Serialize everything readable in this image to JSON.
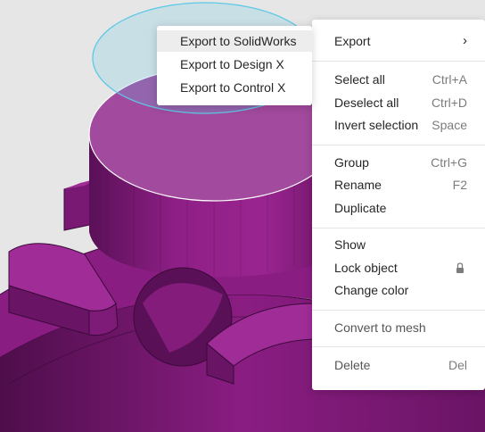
{
  "colors": {
    "background": "#e6e6e6",
    "part": "#8e1f86",
    "part_dark": "#5a1057",
    "selection_fill": "#a24a9e",
    "selection_outline": "#5ec8e6",
    "menu_bg": "#ffffff"
  },
  "context_menu": {
    "export": {
      "label": "Export",
      "submenu_icon": "chevron-right"
    },
    "select_all": {
      "label": "Select all",
      "shortcut": "Ctrl+A"
    },
    "deselect_all": {
      "label": "Deselect all",
      "shortcut": "Ctrl+D"
    },
    "invert_selection": {
      "label": "Invert selection",
      "shortcut": "Space"
    },
    "group": {
      "label": "Group",
      "shortcut": "Ctrl+G"
    },
    "rename": {
      "label": "Rename",
      "shortcut": "F2"
    },
    "duplicate": {
      "label": "Duplicate"
    },
    "show": {
      "label": "Show"
    },
    "lock_object": {
      "label": "Lock object",
      "icon": "lock-icon"
    },
    "change_color": {
      "label": "Change color"
    },
    "convert_to_mesh": {
      "label": "Convert to mesh"
    },
    "delete": {
      "label": "Delete",
      "shortcut": "Del"
    }
  },
  "export_submenu": {
    "items": [
      {
        "label": "Export to SolidWorks",
        "highlighted": true
      },
      {
        "label": "Export to Design X",
        "highlighted": false
      },
      {
        "label": "Export to Control X",
        "highlighted": false
      }
    ]
  }
}
